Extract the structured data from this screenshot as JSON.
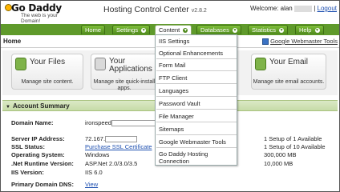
{
  "header": {
    "logo_text": "Go Daddy",
    "logo_tagline": "The web is your Domain!",
    "app_title": "Hosting Control Center",
    "version": "v2.8.2",
    "welcome_prefix": "Welcome: alan",
    "logout_label": "Logout"
  },
  "nav": {
    "tabs": [
      {
        "label": "Home"
      },
      {
        "label": "Settings"
      },
      {
        "label": "Content"
      },
      {
        "label": "Databases"
      },
      {
        "label": "Statistics"
      },
      {
        "label": "Help"
      }
    ],
    "caret": "▼",
    "active": "Content"
  },
  "page": {
    "title": "Home",
    "gwt_link": "Google Webmaster Tools"
  },
  "tiles": [
    {
      "title": "Your Files",
      "desc": "Manage site content."
    },
    {
      "title": "Your Applications",
      "desc": "Manage site quick-install apps."
    },
    {
      "title": "Your Email",
      "desc": "Manage site email accounts."
    }
  ],
  "dropdown": {
    "items": [
      "IIS Settings",
      "Optional Enhancements",
      "Form Mail",
      "FTP Client",
      "Languages",
      "Password Vault",
      "File Manager",
      "Sitemaps",
      "Google Webmaster Tools",
      "Go Daddy Hosting Connection"
    ]
  },
  "summary": {
    "heading": "Account Summary",
    "rows": [
      {
        "label": "Domain Name:",
        "value": "ironspeed"
      },
      {
        "label": "Server IP Address:",
        "value": "72.167."
      },
      {
        "label": "SSL Status:",
        "value": "Purchase SSL Certificate"
      },
      {
        "label": "Operating System:",
        "value": "Windows"
      },
      {
        "label": ".Net Runtime Version:",
        "value": "ASP.Net 2.0/3.0/3.5"
      },
      {
        "label": "IIS Version:",
        "value": "IIS 6.0"
      },
      {
        "label": "Primary Domain DNS:",
        "value": "View"
      }
    ],
    "right_values": [
      "1 Setup of 1 Available",
      "1 Setup of 10 Available",
      "300,000 MB",
      "10,000 MB"
    ]
  },
  "colors": {
    "nav_green": "#5f9a2b",
    "link_blue": "#1d4fb0",
    "summary_green": "#c6dba7"
  }
}
